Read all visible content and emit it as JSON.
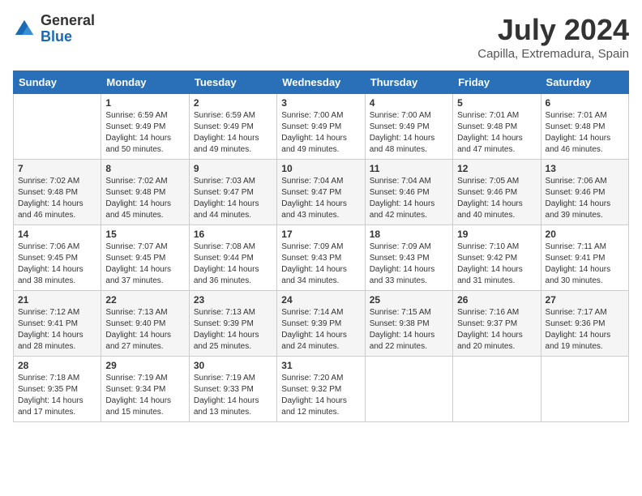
{
  "header": {
    "logo_general": "General",
    "logo_blue": "Blue",
    "month_year": "July 2024",
    "location": "Capilla, Extremadura, Spain"
  },
  "calendar": {
    "days_of_week": [
      "Sunday",
      "Monday",
      "Tuesday",
      "Wednesday",
      "Thursday",
      "Friday",
      "Saturday"
    ],
    "weeks": [
      [
        {
          "day": "",
          "info": ""
        },
        {
          "day": "1",
          "info": "Sunrise: 6:59 AM\nSunset: 9:49 PM\nDaylight: 14 hours\nand 50 minutes."
        },
        {
          "day": "2",
          "info": "Sunrise: 6:59 AM\nSunset: 9:49 PM\nDaylight: 14 hours\nand 49 minutes."
        },
        {
          "day": "3",
          "info": "Sunrise: 7:00 AM\nSunset: 9:49 PM\nDaylight: 14 hours\nand 49 minutes."
        },
        {
          "day": "4",
          "info": "Sunrise: 7:00 AM\nSunset: 9:49 PM\nDaylight: 14 hours\nand 48 minutes."
        },
        {
          "day": "5",
          "info": "Sunrise: 7:01 AM\nSunset: 9:48 PM\nDaylight: 14 hours\nand 47 minutes."
        },
        {
          "day": "6",
          "info": "Sunrise: 7:01 AM\nSunset: 9:48 PM\nDaylight: 14 hours\nand 46 minutes."
        }
      ],
      [
        {
          "day": "7",
          "info": "Sunrise: 7:02 AM\nSunset: 9:48 PM\nDaylight: 14 hours\nand 46 minutes."
        },
        {
          "day": "8",
          "info": "Sunrise: 7:02 AM\nSunset: 9:48 PM\nDaylight: 14 hours\nand 45 minutes."
        },
        {
          "day": "9",
          "info": "Sunrise: 7:03 AM\nSunset: 9:47 PM\nDaylight: 14 hours\nand 44 minutes."
        },
        {
          "day": "10",
          "info": "Sunrise: 7:04 AM\nSunset: 9:47 PM\nDaylight: 14 hours\nand 43 minutes."
        },
        {
          "day": "11",
          "info": "Sunrise: 7:04 AM\nSunset: 9:46 PM\nDaylight: 14 hours\nand 42 minutes."
        },
        {
          "day": "12",
          "info": "Sunrise: 7:05 AM\nSunset: 9:46 PM\nDaylight: 14 hours\nand 40 minutes."
        },
        {
          "day": "13",
          "info": "Sunrise: 7:06 AM\nSunset: 9:46 PM\nDaylight: 14 hours\nand 39 minutes."
        }
      ],
      [
        {
          "day": "14",
          "info": "Sunrise: 7:06 AM\nSunset: 9:45 PM\nDaylight: 14 hours\nand 38 minutes."
        },
        {
          "day": "15",
          "info": "Sunrise: 7:07 AM\nSunset: 9:45 PM\nDaylight: 14 hours\nand 37 minutes."
        },
        {
          "day": "16",
          "info": "Sunrise: 7:08 AM\nSunset: 9:44 PM\nDaylight: 14 hours\nand 36 minutes."
        },
        {
          "day": "17",
          "info": "Sunrise: 7:09 AM\nSunset: 9:43 PM\nDaylight: 14 hours\nand 34 minutes."
        },
        {
          "day": "18",
          "info": "Sunrise: 7:09 AM\nSunset: 9:43 PM\nDaylight: 14 hours\nand 33 minutes."
        },
        {
          "day": "19",
          "info": "Sunrise: 7:10 AM\nSunset: 9:42 PM\nDaylight: 14 hours\nand 31 minutes."
        },
        {
          "day": "20",
          "info": "Sunrise: 7:11 AM\nSunset: 9:41 PM\nDaylight: 14 hours\nand 30 minutes."
        }
      ],
      [
        {
          "day": "21",
          "info": "Sunrise: 7:12 AM\nSunset: 9:41 PM\nDaylight: 14 hours\nand 28 minutes."
        },
        {
          "day": "22",
          "info": "Sunrise: 7:13 AM\nSunset: 9:40 PM\nDaylight: 14 hours\nand 27 minutes."
        },
        {
          "day": "23",
          "info": "Sunrise: 7:13 AM\nSunset: 9:39 PM\nDaylight: 14 hours\nand 25 minutes."
        },
        {
          "day": "24",
          "info": "Sunrise: 7:14 AM\nSunset: 9:39 PM\nDaylight: 14 hours\nand 24 minutes."
        },
        {
          "day": "25",
          "info": "Sunrise: 7:15 AM\nSunset: 9:38 PM\nDaylight: 14 hours\nand 22 minutes."
        },
        {
          "day": "26",
          "info": "Sunrise: 7:16 AM\nSunset: 9:37 PM\nDaylight: 14 hours\nand 20 minutes."
        },
        {
          "day": "27",
          "info": "Sunrise: 7:17 AM\nSunset: 9:36 PM\nDaylight: 14 hours\nand 19 minutes."
        }
      ],
      [
        {
          "day": "28",
          "info": "Sunrise: 7:18 AM\nSunset: 9:35 PM\nDaylight: 14 hours\nand 17 minutes."
        },
        {
          "day": "29",
          "info": "Sunrise: 7:19 AM\nSunset: 9:34 PM\nDaylight: 14 hours\nand 15 minutes."
        },
        {
          "day": "30",
          "info": "Sunrise: 7:19 AM\nSunset: 9:33 PM\nDaylight: 14 hours\nand 13 minutes."
        },
        {
          "day": "31",
          "info": "Sunrise: 7:20 AM\nSunset: 9:32 PM\nDaylight: 14 hours\nand 12 minutes."
        },
        {
          "day": "",
          "info": ""
        },
        {
          "day": "",
          "info": ""
        },
        {
          "day": "",
          "info": ""
        }
      ]
    ]
  }
}
